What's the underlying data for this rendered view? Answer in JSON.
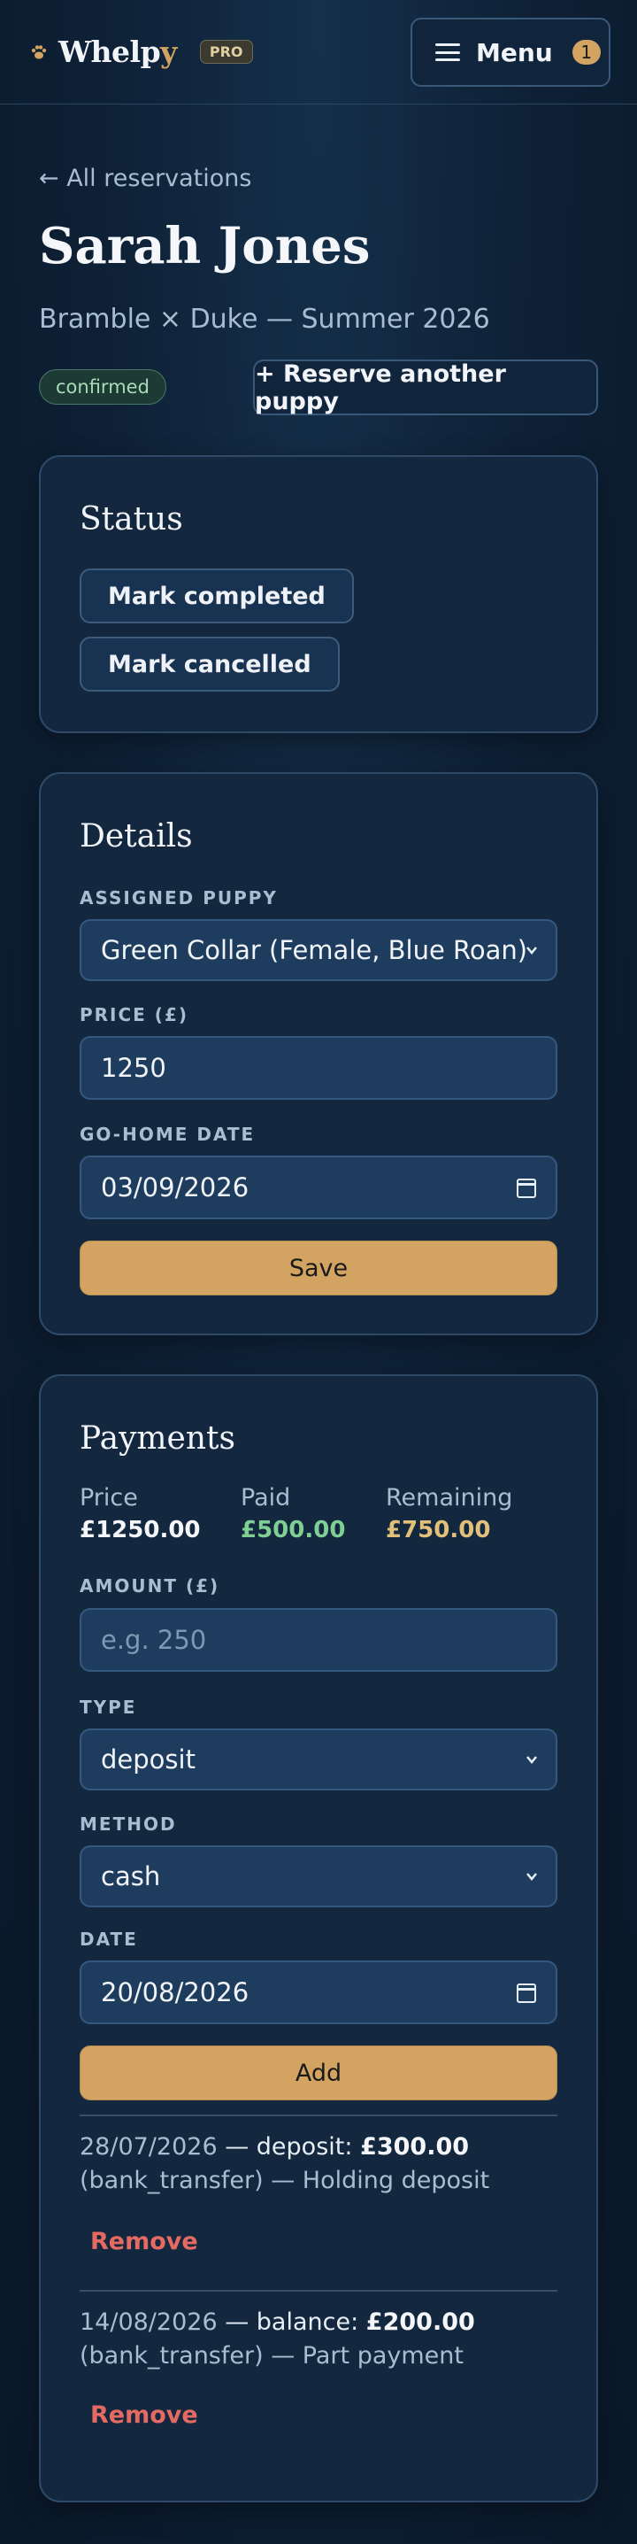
{
  "header": {
    "brand_main": "Whelp",
    "brand_accent": "y",
    "pro_badge": "PRO",
    "menu_label": "Menu",
    "menu_count": "1"
  },
  "nav": {
    "back_link": "← All reservations"
  },
  "page": {
    "title": "Sarah Jones",
    "subtitle": "Bramble × Duke — Summer 2026",
    "status_badge": "confirmed",
    "reserve_button": "+ Reserve another puppy"
  },
  "status_card": {
    "title": "Status",
    "mark_completed": "Mark completed",
    "mark_cancelled": "Mark cancelled"
  },
  "details_card": {
    "title": "Details",
    "assigned_puppy_label": "ASSIGNED PUPPY",
    "assigned_puppy_value": "Green Collar (Female, Blue Roan)",
    "price_label": "PRICE (£)",
    "price_value": "1250",
    "go_home_label": "GO-HOME DATE",
    "go_home_value": "03/09/2026",
    "save_button": "Save"
  },
  "payments_card": {
    "title": "Payments",
    "summary": {
      "price_label": "Price",
      "price_value": "£1250.00",
      "paid_label": "Paid",
      "paid_value": "£500.00",
      "remaining_label": "Remaining",
      "remaining_value": "£750.00"
    },
    "amount_label": "AMOUNT (£)",
    "amount_placeholder": "e.g. 250",
    "type_label": "TYPE",
    "type_value": "deposit",
    "method_label": "METHOD",
    "method_value": "cash",
    "date_label": "DATE",
    "date_value": "20/08/2026",
    "add_button": "Add",
    "items": [
      {
        "date": "28/07/2026",
        "sep": " — ",
        "type": "deposit:",
        "amount": "£300.00",
        "method": "(bank_transfer)",
        "note": " — Holding deposit",
        "remove": "Remove"
      },
      {
        "date": "14/08/2026",
        "sep": " — ",
        "type": "balance:",
        "amount": "£200.00",
        "method": "(bank_transfer)",
        "note": " — Part payment",
        "remove": "Remove"
      }
    ]
  },
  "colors": {
    "accent_gold": "#d3a461",
    "paid_green": "#7fcf94",
    "remaining_gold": "#e2c07a",
    "danger_red": "#e56a62",
    "background": "#0c1c2e"
  },
  "icons": [
    "paw-icon",
    "hamburger-icon",
    "chevron-down-icon",
    "calendar-icon"
  ]
}
